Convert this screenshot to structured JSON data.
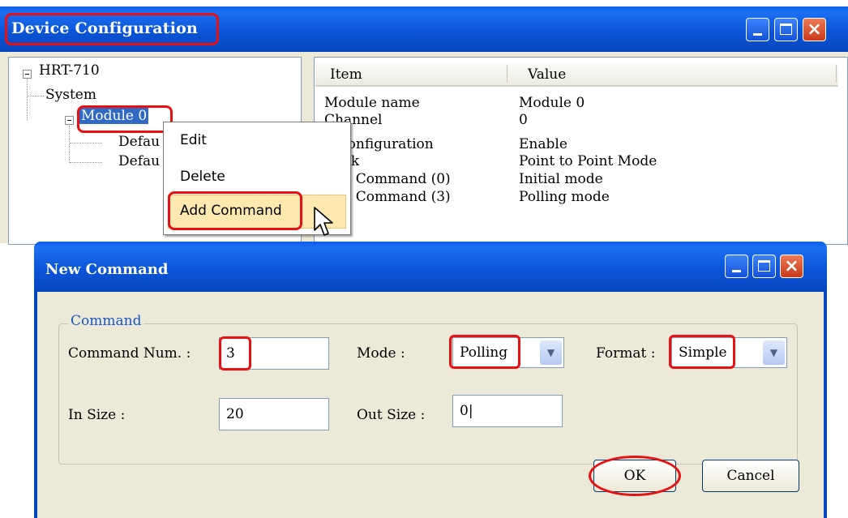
{
  "device_window": {
    "title": "Device Configuration",
    "tree": {
      "root": "HRT-710",
      "system": "System",
      "module": "Module 0",
      "default1": "Defau",
      "default2": "Defau"
    },
    "columns": [
      "Item",
      "Value"
    ],
    "rows": [
      {
        "item": "Module name",
        "value": "Module 0"
      },
      {
        "item": "Channel",
        "value": "0"
      },
      {
        "item": "Auto Configuration",
        "value": "Enable"
      },
      {
        "item": "Network",
        "value": "Point to Point Mode"
      },
      {
        "item": "Default Command (0)",
        "value": "Initial mode"
      },
      {
        "item": "Default Command (3)",
        "value": "Polling mode"
      }
    ],
    "visible_items": [
      "Module name",
      "Channel",
      "o Configuration",
      "work",
      "ault Command (0)",
      "ault Command (3)"
    ],
    "context_menu": {
      "edit": "Edit",
      "delete": "Delete",
      "add_command": "Add Command"
    }
  },
  "new_command_window": {
    "title": "New Command",
    "group_label": "Command",
    "command_num_label": "Command Num. :",
    "command_num_value": "3",
    "mode_label": "Mode :",
    "mode_value": "Polling",
    "format_label": "Format :",
    "format_value": "Simple",
    "in_size_label": "In Size :",
    "in_size_value": "20",
    "out_size_label": "Out Size :",
    "out_size_value": "0|",
    "ok_label": "OK",
    "cancel_label": "Cancel"
  },
  "colors": {
    "titlebar": "#0b55d8",
    "highlight_annotation": "#e81010",
    "menu_highlight": "#fde8b0",
    "group_label": "#1a56c4"
  }
}
